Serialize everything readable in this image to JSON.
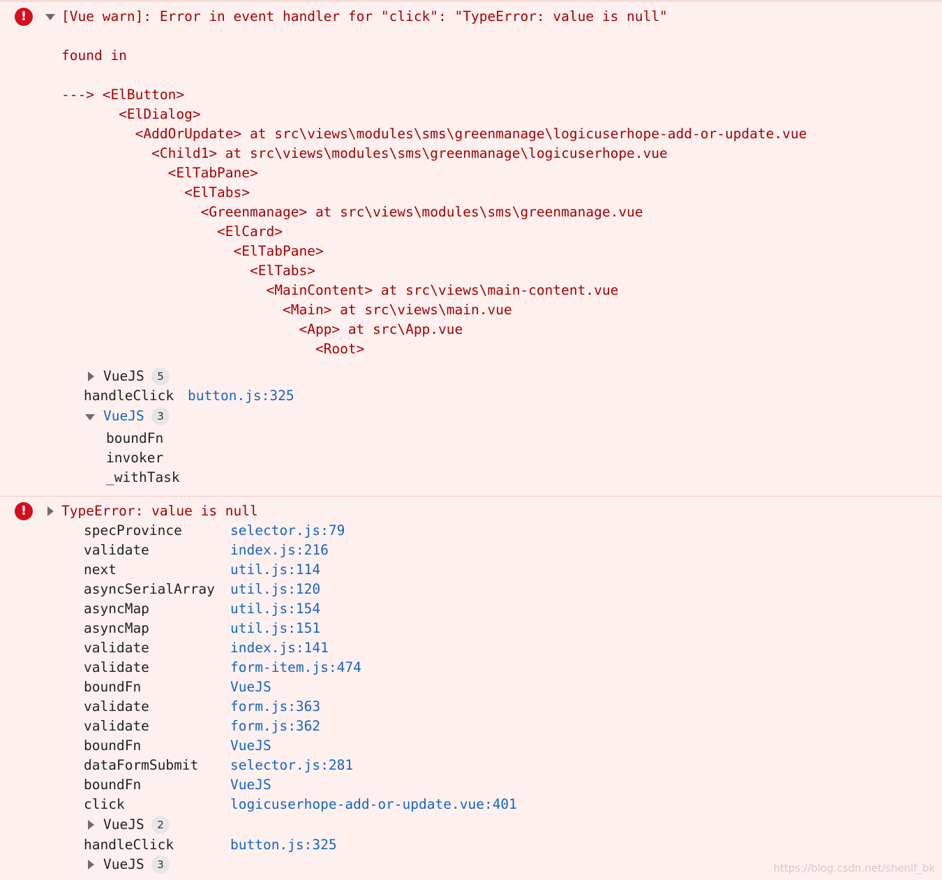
{
  "warning": {
    "message": "[Vue warn]: Error in event handler for \"click\": \"TypeError: value is null\"",
    "found_in": "found in",
    "tree": [
      "---> <ElButton>",
      "       <ElDialog>",
      "         <AddOrUpdate> at src\\views\\modules\\sms\\greenmanage\\logicuserhope-add-or-update.vue",
      "           <Child1> at src\\views\\modules\\sms\\greenmanage\\logicuserhope.vue",
      "             <ElTabPane>",
      "               <ElTabs>",
      "                 <Greenmanage> at src\\views\\modules\\sms\\greenmanage.vue",
      "                   <ElCard>",
      "                     <ElTabPane>",
      "                       <ElTabs>",
      "                         <MainContent> at src\\views\\main-content.vue",
      "                           <Main> at src\\views\\main.vue",
      "                             <App> at src\\App.vue",
      "                               <Root>"
    ],
    "stack": {
      "group1_label": "VueJS",
      "group1_count": "5",
      "handle_fn": "handleClick",
      "handle_file": "button.js",
      "handle_line": ":325",
      "group2_label": "VueJS",
      "group2_count": "3",
      "group2_items": [
        "boundFn",
        "invoker",
        "_withTask"
      ]
    }
  },
  "error": {
    "message": "TypeError: value is null",
    "frames": [
      {
        "fn": "specProvince",
        "file": "selector.js",
        "line": ":79"
      },
      {
        "fn": "validate",
        "file": "index.js",
        "line": ":216"
      },
      {
        "fn": "next",
        "file": "util.js",
        "line": ":114"
      },
      {
        "fn": "asyncSerialArray",
        "file": "util.js",
        "line": ":120"
      },
      {
        "fn": "asyncMap",
        "file": "util.js",
        "line": ":154"
      },
      {
        "fn": "asyncMap",
        "file": "util.js",
        "line": ":151"
      },
      {
        "fn": "validate",
        "file": "index.js",
        "line": ":141"
      },
      {
        "fn": "validate",
        "file": "form-item.js",
        "line": ":474"
      },
      {
        "fn": "boundFn",
        "file": "VueJS",
        "line": ""
      },
      {
        "fn": "validate",
        "file": "form.js",
        "line": ":363"
      },
      {
        "fn": "validate",
        "file": "form.js",
        "line": ":362"
      },
      {
        "fn": "boundFn",
        "file": "VueJS",
        "line": ""
      },
      {
        "fn": "dataFormSubmit",
        "file": "selector.js",
        "line": ":281"
      },
      {
        "fn": "boundFn",
        "file": "VueJS",
        "line": ""
      },
      {
        "fn": "click",
        "file": "logicuserhope-add-or-update.vue",
        "line": ":401"
      }
    ],
    "group3_label": "VueJS",
    "group3_count": "2",
    "handle_fn": "handleClick",
    "handle_file": "button.js",
    "handle_line": ":325",
    "group4_label": "VueJS",
    "group4_count": "3"
  },
  "watermark": "https://blog.csdn.net/shenlf_bk"
}
